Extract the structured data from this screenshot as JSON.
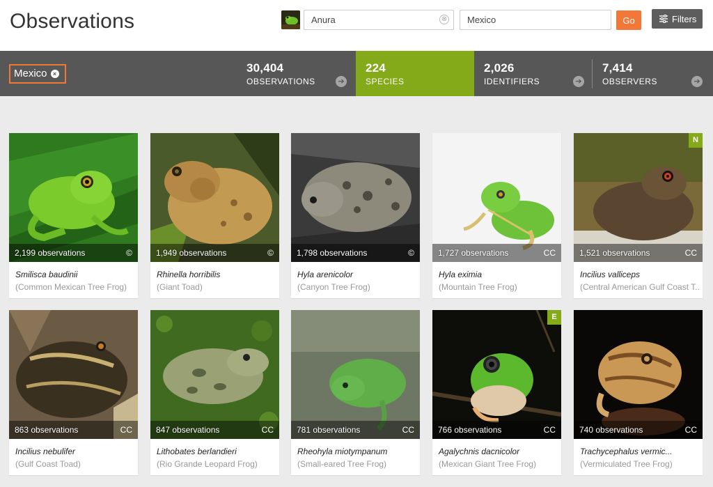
{
  "page": {
    "title": "Observations"
  },
  "search": {
    "taxon_value": "Anura",
    "place_value": "Mexico",
    "go_label": "Go",
    "filters_label": "Filters",
    "clear_symbol": "⊗"
  },
  "place_chip": {
    "label": "Mexico",
    "close_symbol": "×"
  },
  "stats": [
    {
      "value": "30,404",
      "label": "OBSERVATIONS"
    },
    {
      "value": "224",
      "label": "SPECIES"
    },
    {
      "value": "2,026",
      "label": "IDENTIFIERS"
    },
    {
      "value": "7,414",
      "label": "OBSERVERS"
    }
  ],
  "stat_arrow": "➔",
  "colors": {
    "accent_orange": "#f27838",
    "accent_green": "#84a919",
    "stats_bg": "#575757",
    "page_bg": "#ebebeb"
  },
  "species": [
    {
      "observations": "2,199 observations",
      "license": "©",
      "sci_name": "Smilisca baudinii",
      "common_name": "(Common Mexican Tree Frog)",
      "badge": ""
    },
    {
      "observations": "1,949 observations",
      "license": "©",
      "sci_name": "Rhinella horribilis",
      "common_name": "(Giant Toad)",
      "badge": ""
    },
    {
      "observations": "1,798 observations",
      "license": "©",
      "sci_name": "Hyla arenicolor",
      "common_name": "(Canyon Tree Frog)",
      "badge": ""
    },
    {
      "observations": "1,727 observations",
      "license": "CC",
      "sci_name": "Hyla eximia",
      "common_name": "(Mountain Tree Frog)",
      "badge": ""
    },
    {
      "observations": "1,521 observations",
      "license": "CC",
      "sci_name": "Incilius valliceps",
      "common_name": "(Central American Gulf Coast T...",
      "badge": "N"
    },
    {
      "observations": "863 observations",
      "license": "CC",
      "sci_name": "Incilius nebulifer",
      "common_name": "(Gulf Coast Toad)",
      "badge": ""
    },
    {
      "observations": "847 observations",
      "license": "CC",
      "sci_name": "Lithobates berlandieri",
      "common_name": "(Rio Grande Leopard Frog)",
      "badge": ""
    },
    {
      "observations": "781 observations",
      "license": "CC",
      "sci_name": "Rheohyla miotympanum",
      "common_name": "(Small-eared Tree Frog)",
      "badge": ""
    },
    {
      "observations": "766 observations",
      "license": "CC",
      "sci_name": "Agalychnis dacnicolor",
      "common_name": "(Mexican Giant Tree Frog)",
      "badge": "E"
    },
    {
      "observations": "740 observations",
      "license": "CC",
      "sci_name": "Trachycephalus vermic...",
      "common_name": "(Vermiculated Tree Frog)",
      "badge": ""
    }
  ]
}
